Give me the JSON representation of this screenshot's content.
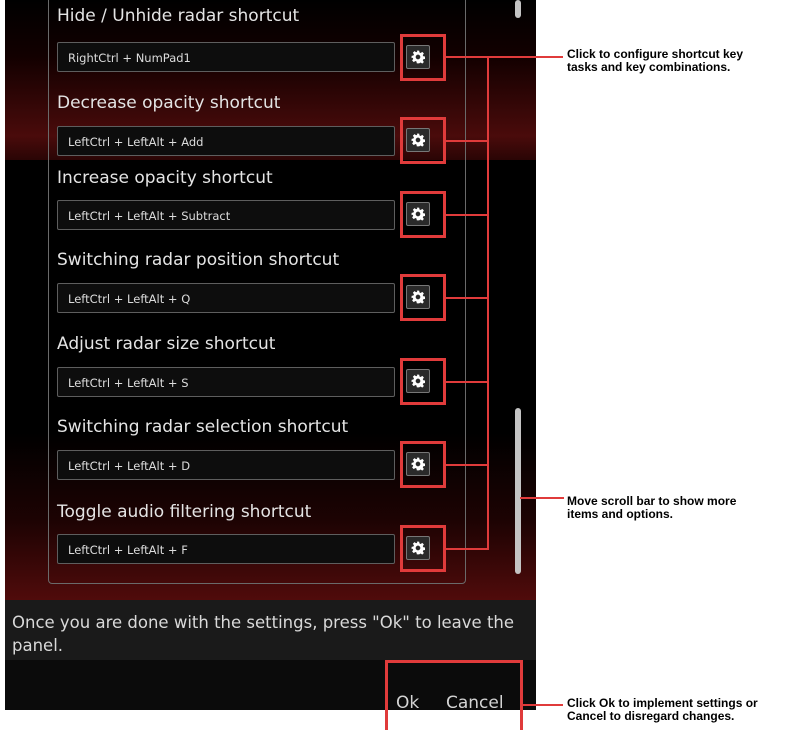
{
  "shortcuts": [
    {
      "label": "Hide / Unhide radar shortcut",
      "value": "RightCtrl + NumPad1"
    },
    {
      "label": "Decrease opacity shortcut",
      "value": "LeftCtrl + LeftAlt + Add"
    },
    {
      "label": "Increase opacity shortcut",
      "value": "LeftCtrl + LeftAlt + Subtract"
    },
    {
      "label": "Switching radar position shortcut",
      "value": "LeftCtrl + LeftAlt + Q"
    },
    {
      "label": "Adjust radar size shortcut",
      "value": "LeftCtrl + LeftAlt + S"
    },
    {
      "label": "Switching radar selection shortcut",
      "value": "LeftCtrl + LeftAlt + D"
    },
    {
      "label": "Toggle audio filtering shortcut",
      "value": "LeftCtrl + LeftAlt + F"
    }
  ],
  "footer": {
    "info": "Once you are done with the settings, press \"Ok\" to leave the panel.",
    "ok_label": "Ok",
    "cancel_label": "Cancel"
  },
  "callouts": {
    "shortcut_config_line1": "Click to configure shortcut key",
    "shortcut_config_line2": "tasks and key combinations.",
    "scroll_line1": "Move scroll bar to show more",
    "scroll_line2": "items and options.",
    "okcancel_line1": "Click Ok to implement settings or",
    "okcancel_line2": "Cancel to disregard changes."
  },
  "icons": {
    "config_button": "gear-icon"
  },
  "colors": {
    "highlight": "#e03b3b",
    "panel_bg": "#0a0a0a",
    "accent_red": "#500b0b"
  }
}
